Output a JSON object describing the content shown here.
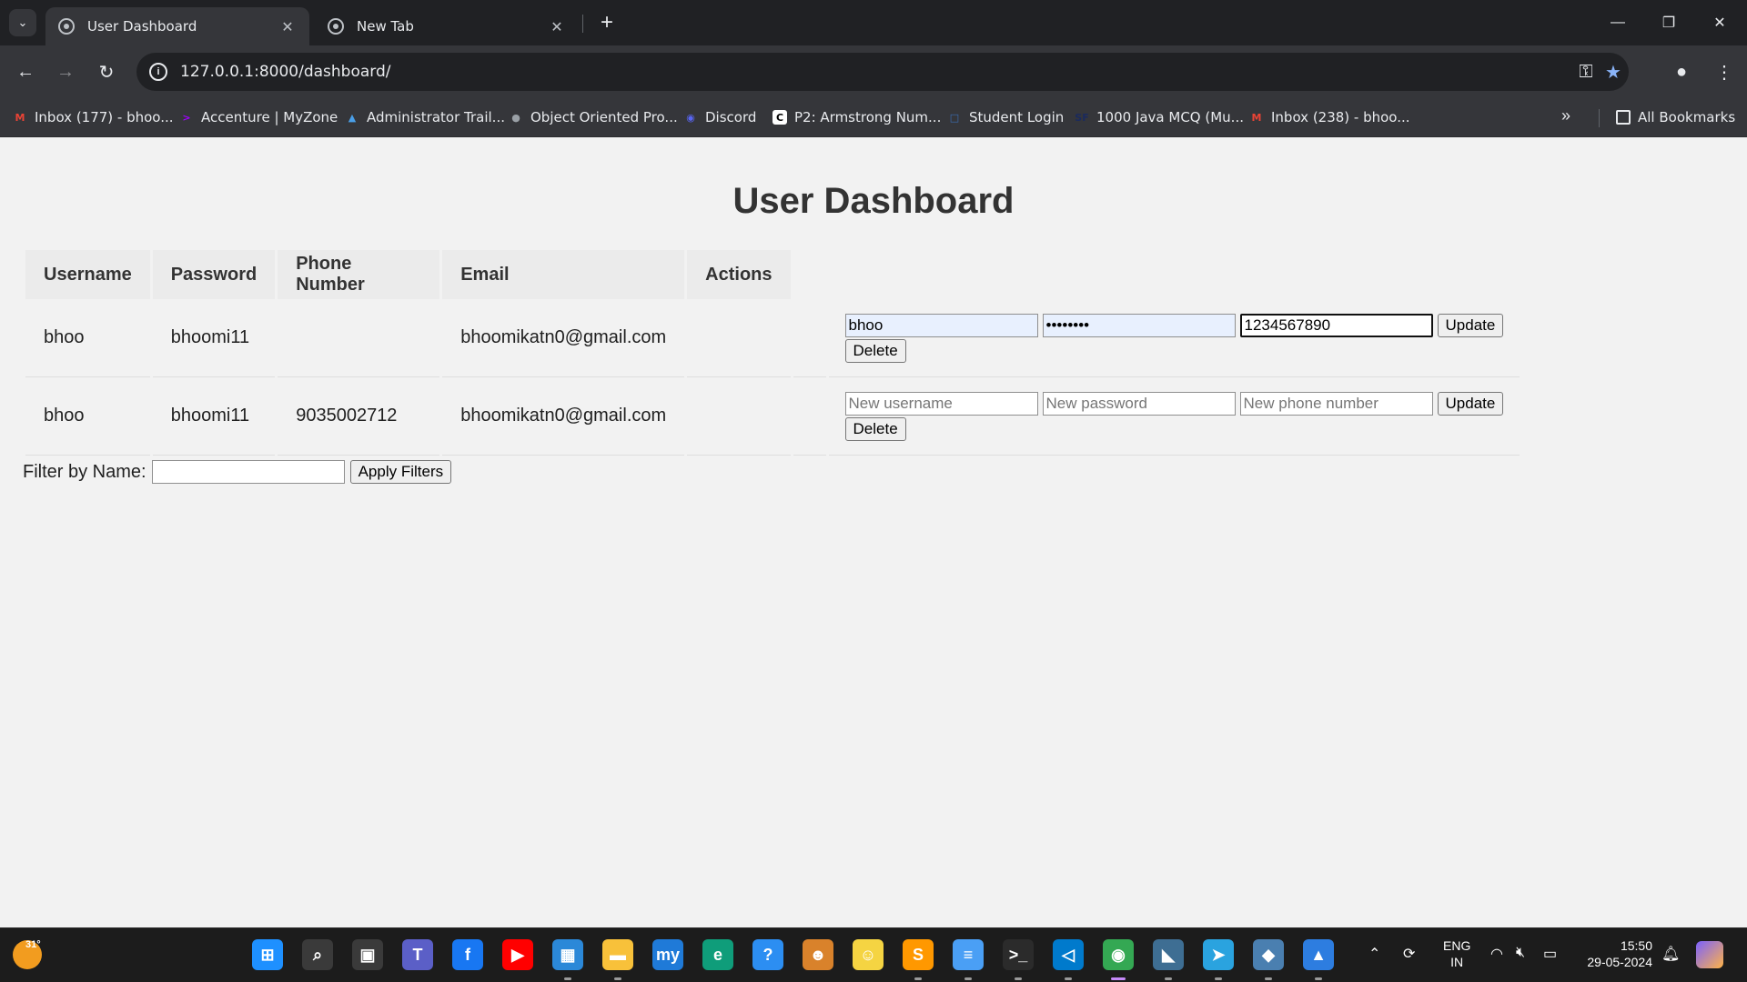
{
  "browser": {
    "tabs": [
      {
        "title": "User Dashboard",
        "active": true
      },
      {
        "title": "New Tab",
        "active": false
      }
    ],
    "url": "127.0.0.1:8000/dashboard/",
    "bookmarks": [
      {
        "label": "Inbox (177) - bhoo...",
        "icon": "gmail-icon",
        "color": "#ea4335",
        "glyph": "M"
      },
      {
        "label": "Accenture | MyZone",
        "icon": "accenture-icon",
        "color": "#a100ff",
        "glyph": ">"
      },
      {
        "label": "Administrator Trail...",
        "icon": "trailhead-icon",
        "color": "#4a9fe8",
        "glyph": "▲"
      },
      {
        "label": "Object Oriented Pro...",
        "icon": "globe-icon",
        "color": "#9aa0a6",
        "glyph": "●"
      },
      {
        "label": "Discord",
        "icon": "discord-icon",
        "color": "#5865f2",
        "glyph": "◉"
      },
      {
        "label": "P2: Armstrong Num...",
        "icon": "c-icon",
        "color": "#ffffff",
        "glyph": "C"
      },
      {
        "label": "Student Login",
        "icon": "student-icon",
        "color": "#3b6fb6",
        "glyph": "□"
      },
      {
        "label": "1000 Java MCQ (Mu...",
        "icon": "sf-icon",
        "color": "#1a2a5e",
        "glyph": "SF"
      },
      {
        "label": "Inbox (238) - bhoo...",
        "icon": "gmail-icon",
        "color": "#ea4335",
        "glyph": "M"
      }
    ],
    "all_bookmarks_label": "All Bookmarks"
  },
  "page": {
    "title": "User Dashboard",
    "table": {
      "headers": [
        "Username",
        "Password",
        "Phone Number",
        "Email",
        "Actions"
      ],
      "rows": [
        {
          "username": "bhoo",
          "password": "bhoomi11",
          "phone": "",
          "email": "bhoomikatn0@gmail.com",
          "form": {
            "username_value": "bhoo",
            "password_value": "••••••••",
            "phone_value": "1234567890"
          }
        },
        {
          "username": "bhoo",
          "password": "bhoomi11",
          "phone": "9035002712",
          "email": "bhoomikatn0@gmail.com",
          "form": {
            "username_value": "",
            "password_value": "",
            "phone_value": ""
          }
        }
      ],
      "placeholders": {
        "username": "New username",
        "password": "New password",
        "phone": "New phone number"
      },
      "update_label": "Update",
      "delete_label": "Delete"
    },
    "filter": {
      "label": "Filter by Name:",
      "value": "",
      "button_label": "Apply Filters"
    }
  },
  "taskbar": {
    "weather_temp": "31°",
    "language": [
      "ENG",
      "IN"
    ],
    "time": "15:50",
    "date": "29-05-2024",
    "apps": [
      {
        "name": "start-icon",
        "color": "#1e90ff"
      },
      {
        "name": "search-icon",
        "color": "#3a3a3a"
      },
      {
        "name": "task-view-icon",
        "color": "#3a3a3a"
      },
      {
        "name": "teams-icon",
        "color": "#5b5fc7"
      },
      {
        "name": "facebook-icon",
        "color": "#1877f2"
      },
      {
        "name": "youtube-icon",
        "color": "#ff0000"
      },
      {
        "name": "store-icon",
        "color": "#2b88d8"
      },
      {
        "name": "file-explorer-icon",
        "color": "#f8c13a"
      },
      {
        "name": "mylib-icon",
        "color": "#1f7ad8"
      },
      {
        "name": "edge-icon",
        "color": "#0f9d7a"
      },
      {
        "name": "help-icon",
        "color": "#2c8ef2"
      },
      {
        "name": "game-icon",
        "color": "#d9822b"
      },
      {
        "name": "spongebob-icon",
        "color": "#f5d442"
      },
      {
        "name": "sublime-icon",
        "color": "#ff9800"
      },
      {
        "name": "notepad-icon",
        "color": "#4a9ff5"
      },
      {
        "name": "terminal-icon",
        "color": "#2b2b2b"
      },
      {
        "name": "vscode-icon",
        "color": "#007acc"
      },
      {
        "name": "chrome-icon",
        "color": "#34a853"
      },
      {
        "name": "mysql-icon",
        "color": "#3e6e93"
      },
      {
        "name": "telegram-icon",
        "color": "#2aa3df"
      },
      {
        "name": "python-icon",
        "color": "#4a7fb0"
      },
      {
        "name": "photos-icon",
        "color": "#2d7de0"
      }
    ]
  }
}
